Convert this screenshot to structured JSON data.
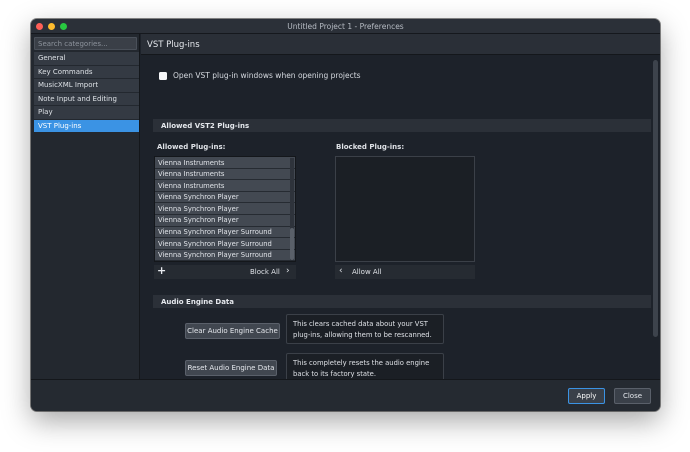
{
  "window": {
    "title": "Untitled Project 1 - Preferences"
  },
  "sidebar": {
    "search_placeholder": "Search categories...",
    "items": [
      {
        "label": "General"
      },
      {
        "label": "Key Commands"
      },
      {
        "label": "MusicXML Import"
      },
      {
        "label": "Note Input and Editing"
      },
      {
        "label": "Play"
      },
      {
        "label": "VST Plug-ins",
        "active": true
      }
    ]
  },
  "page": {
    "title": "VST Plug-ins",
    "open_windows_checkbox": {
      "label": "Open VST plug-in windows when opening projects",
      "checked": false
    },
    "allowed_section": {
      "title": "Allowed VST2 Plug-ins",
      "allowed_label": "Allowed Plug-ins:",
      "blocked_label": "Blocked Plug-ins:",
      "allowed_items": [
        "Vienna Instruments",
        "Vienna Instruments",
        "Vienna Instruments",
        "Vienna Synchron Player",
        "Vienna Synchron Player",
        "Vienna Synchron Player",
        "Vienna Synchron Player Surround",
        "Vienna Synchron Player Surround",
        "Vienna Synchron Player Surround"
      ],
      "add_glyph": "+",
      "block_all_label": "Block All",
      "allow_all_label": "Allow All"
    },
    "audio_engine_section": {
      "title": "Audio Engine Data",
      "clear_cache_label": "Clear Audio Engine Cache",
      "clear_cache_desc": "This clears cached data about your VST plug-ins, allowing them to be rescanned.",
      "reset_data_label": "Reset Audio Engine Data",
      "reset_data_desc": "This completely resets the audio engine back to its factory state."
    }
  },
  "footer": {
    "apply_label": "Apply",
    "close_label": "Close"
  },
  "colors": {
    "accent": "#3b93e4",
    "background": "#1d222a"
  }
}
